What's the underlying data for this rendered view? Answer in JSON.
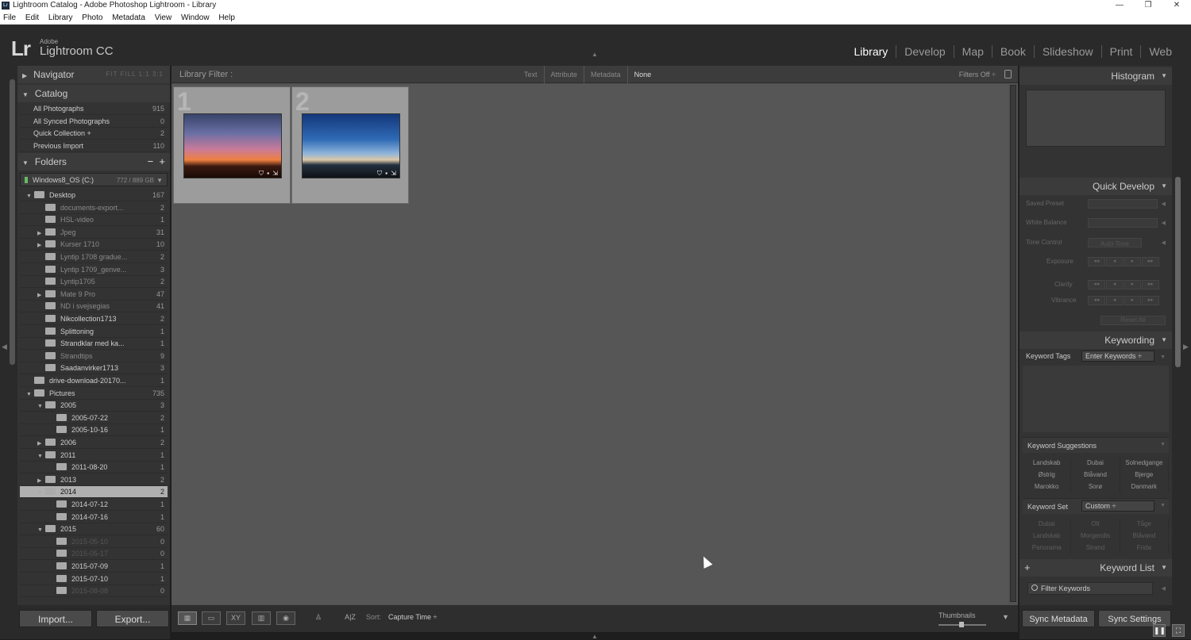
{
  "window": {
    "title": "Lightroom Catalog - Adobe Photoshop Lightroom - Library",
    "minimize": "—",
    "restore": "❐",
    "close": "✕"
  },
  "menu": [
    "File",
    "Edit",
    "Library",
    "Photo",
    "Metadata",
    "View",
    "Window",
    "Help"
  ],
  "identity": {
    "logo": "Lr",
    "brand": "Adobe",
    "product": "Lightroom CC"
  },
  "modules": [
    "Library",
    "Develop",
    "Map",
    "Book",
    "Slideshow",
    "Print",
    "Web"
  ],
  "navigator": {
    "title": "Navigator",
    "options": "FIT  FILL  1:1  3:1"
  },
  "catalog": {
    "title": "Catalog",
    "items": [
      {
        "label": "All Photographs",
        "count": "915"
      },
      {
        "label": "All Synced Photographs",
        "count": "0"
      },
      {
        "label": "Quick Collection +",
        "count": "2"
      },
      {
        "label": "Previous Import",
        "count": "110"
      }
    ]
  },
  "folders": {
    "title": "Folders",
    "minus": "−",
    "plus": "+",
    "volume": {
      "name": "Windows8_OS (C:)",
      "capacity": "772 / 889 GB"
    },
    "items": [
      {
        "label": "Desktop",
        "count": "167",
        "indent": 0,
        "arrow": "▼",
        "state": "normal"
      },
      {
        "label": "documents-export...",
        "count": "2",
        "indent": 1,
        "arrow": "",
        "state": "dim"
      },
      {
        "label": "HSL-video",
        "count": "1",
        "indent": 1,
        "arrow": "",
        "state": "dim"
      },
      {
        "label": "Jpeg",
        "count": "31",
        "indent": 1,
        "arrow": "▶",
        "state": "dim"
      },
      {
        "label": "Kurser 1710",
        "count": "10",
        "indent": 1,
        "arrow": "▶",
        "state": "dim"
      },
      {
        "label": "Lyntip 1708 gradue...",
        "count": "2",
        "indent": 1,
        "arrow": "",
        "state": "dim"
      },
      {
        "label": "Lyntip 1709_genve...",
        "count": "3",
        "indent": 1,
        "arrow": "",
        "state": "dim"
      },
      {
        "label": "Lyntip1705",
        "count": "2",
        "indent": 1,
        "arrow": "",
        "state": "dim"
      },
      {
        "label": "Mate 9 Pro",
        "count": "47",
        "indent": 1,
        "arrow": "▶",
        "state": "dim"
      },
      {
        "label": "ND i svejsegias",
        "count": "41",
        "indent": 1,
        "arrow": "",
        "state": "dim"
      },
      {
        "label": "Nikcollection1713",
        "count": "2",
        "indent": 1,
        "arrow": "",
        "state": "normal"
      },
      {
        "label": "Splittoning",
        "count": "1",
        "indent": 1,
        "arrow": "",
        "state": "normal"
      },
      {
        "label": "Strandklar med ka...",
        "count": "1",
        "indent": 1,
        "arrow": "",
        "state": "normal"
      },
      {
        "label": "Strandtips",
        "count": "9",
        "indent": 1,
        "arrow": "",
        "state": "dim"
      },
      {
        "label": "Saadanvirker1713",
        "count": "3",
        "indent": 1,
        "arrow": "",
        "state": "normal"
      },
      {
        "label": "drive-download-20170...",
        "count": "1",
        "indent": 0,
        "arrow": "",
        "state": "normal"
      },
      {
        "label": "Pictures",
        "count": "735",
        "indent": 0,
        "arrow": "▼",
        "state": "normal"
      },
      {
        "label": "2005",
        "count": "3",
        "indent": 1,
        "arrow": "▼",
        "state": "normal"
      },
      {
        "label": "2005-07-22",
        "count": "2",
        "indent": 2,
        "arrow": "",
        "state": "normal"
      },
      {
        "label": "2005-10-16",
        "count": "1",
        "indent": 2,
        "arrow": "",
        "state": "normal"
      },
      {
        "label": "2006",
        "count": "2",
        "indent": 1,
        "arrow": "▶",
        "state": "normal"
      },
      {
        "label": "2011",
        "count": "1",
        "indent": 1,
        "arrow": "▼",
        "state": "normal"
      },
      {
        "label": "2011-08-20",
        "count": "1",
        "indent": 2,
        "arrow": "",
        "state": "normal"
      },
      {
        "label": "2013",
        "count": "2",
        "indent": 1,
        "arrow": "▶",
        "state": "normal"
      },
      {
        "label": "2014",
        "count": "2",
        "indent": 1,
        "arrow": "▼",
        "state": "sel"
      },
      {
        "label": "2014-07-12",
        "count": "1",
        "indent": 2,
        "arrow": "",
        "state": "normal"
      },
      {
        "label": "2014-07-16",
        "count": "1",
        "indent": 2,
        "arrow": "",
        "state": "normal"
      },
      {
        "label": "2015",
        "count": "60",
        "indent": 1,
        "arrow": "▼",
        "state": "normal"
      },
      {
        "label": "2015-05-10",
        "count": "0",
        "indent": 2,
        "arrow": "",
        "state": "vdim"
      },
      {
        "label": "2015-05-17",
        "count": "0",
        "indent": 2,
        "arrow": "",
        "state": "vdim"
      },
      {
        "label": "2015-07-09",
        "count": "1",
        "indent": 2,
        "arrow": "",
        "state": "normal"
      },
      {
        "label": "2015-07-10",
        "count": "1",
        "indent": 2,
        "arrow": "",
        "state": "normal"
      },
      {
        "label": "2015-08-08",
        "count": "0",
        "indent": 2,
        "arrow": "",
        "state": "vdim"
      }
    ]
  },
  "leftbuttons": {
    "import": "Import...",
    "export": "Export..."
  },
  "filterbar": {
    "label": "Library Filter :",
    "options": [
      "Text",
      "Attribute",
      "Metadata",
      "None"
    ],
    "active": "None",
    "status": "Filters Off ÷"
  },
  "grid": {
    "cells": [
      {
        "number": "1",
        "badges": "⛉ ▪ ⇲"
      },
      {
        "number": "2",
        "badges": "⛉ ▪ ⇲"
      }
    ]
  },
  "toolbar": {
    "icons": [
      "▦",
      "▭",
      "XY",
      "▥",
      "◉",
      "♙",
      "A|Z"
    ],
    "sort_label": "Sort:",
    "sort_value": "Capture Time ÷",
    "thumbnails_label": "Thumbnails",
    "dropdown": "▼"
  },
  "histogram": {
    "title": "Histogram"
  },
  "quickdevelop": {
    "title": "Quick Develop",
    "saved_preset": "Saved Preset",
    "white_balance": "White Balance",
    "tone_control": "Tone Control",
    "auto_tone": "Auto Tone",
    "exposure": "Exposure",
    "clarity": "Clarity",
    "vibrance": "Vibrance",
    "reset_all": "Reset All",
    "steps": [
      "◂◂",
      "◂",
      "▸",
      "▸▸"
    ]
  },
  "keywording": {
    "title": "Keywording",
    "tags_label": "Keyword Tags",
    "tags_value": "Enter Keywords ÷",
    "suggestions_title": "Keyword Suggestions",
    "suggestions": [
      "Landskab",
      "Dubai",
      "Solnedgange",
      "Østrig",
      "Blåvand",
      "Bjerge",
      "Marokko",
      "Sorø",
      "Danmark"
    ],
    "set_label": "Keyword Set",
    "set_value": "Custom ÷",
    "set_keywords": [
      "Dubai",
      "Olt",
      "Tåge",
      "Landskab",
      "Morgendis",
      "Blåvand",
      "Panorama",
      "Strand",
      "Frida"
    ]
  },
  "keywordlist": {
    "title": "Keyword List",
    "plus": "+",
    "filter_placeholder": "Filter Keywords"
  },
  "syncbuttons": {
    "metadata": "Sync Metadata",
    "settings": "Sync Settings"
  },
  "corner": {
    "a": "❚❚",
    "b": "⛶"
  }
}
